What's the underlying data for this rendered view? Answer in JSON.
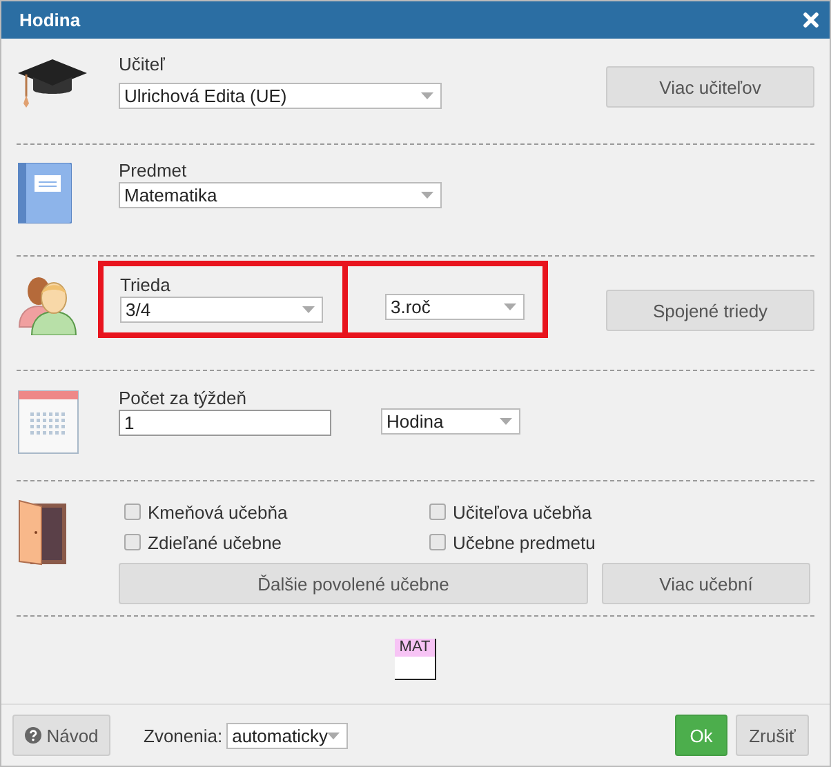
{
  "window": {
    "title": "Hodina"
  },
  "teacher": {
    "label": "Učiteľ",
    "value": "Ulrichová Edita (UE)",
    "button": "Viac učiteľov"
  },
  "subject": {
    "label": "Predmet",
    "value": "Matematika"
  },
  "class": {
    "label": "Trieda",
    "value": "3/4",
    "grade": "3.roč",
    "highlighted": true,
    "button": "Spojené triedy"
  },
  "per_week": {
    "label": "Počet za týždeň",
    "value": "1",
    "unit": "Hodina"
  },
  "rooms": {
    "checkboxes": [
      {
        "label": "Kmeňová učebňa",
        "checked": false
      },
      {
        "label": "Učiteľova učebňa",
        "checked": false
      },
      {
        "label": "Zdieľané učebne",
        "checked": false
      },
      {
        "label": "Učebne predmetu",
        "checked": false
      }
    ],
    "buttons": [
      "Ďalšie povolené učebne",
      "Viac učební"
    ]
  },
  "card": {
    "text": "MAT"
  },
  "footer": {
    "help_button": "Návod",
    "bells_label": "Zvonenia:",
    "bells_value": "automaticky",
    "ok_button": "Ok",
    "cancel_button": "Zrušiť"
  }
}
